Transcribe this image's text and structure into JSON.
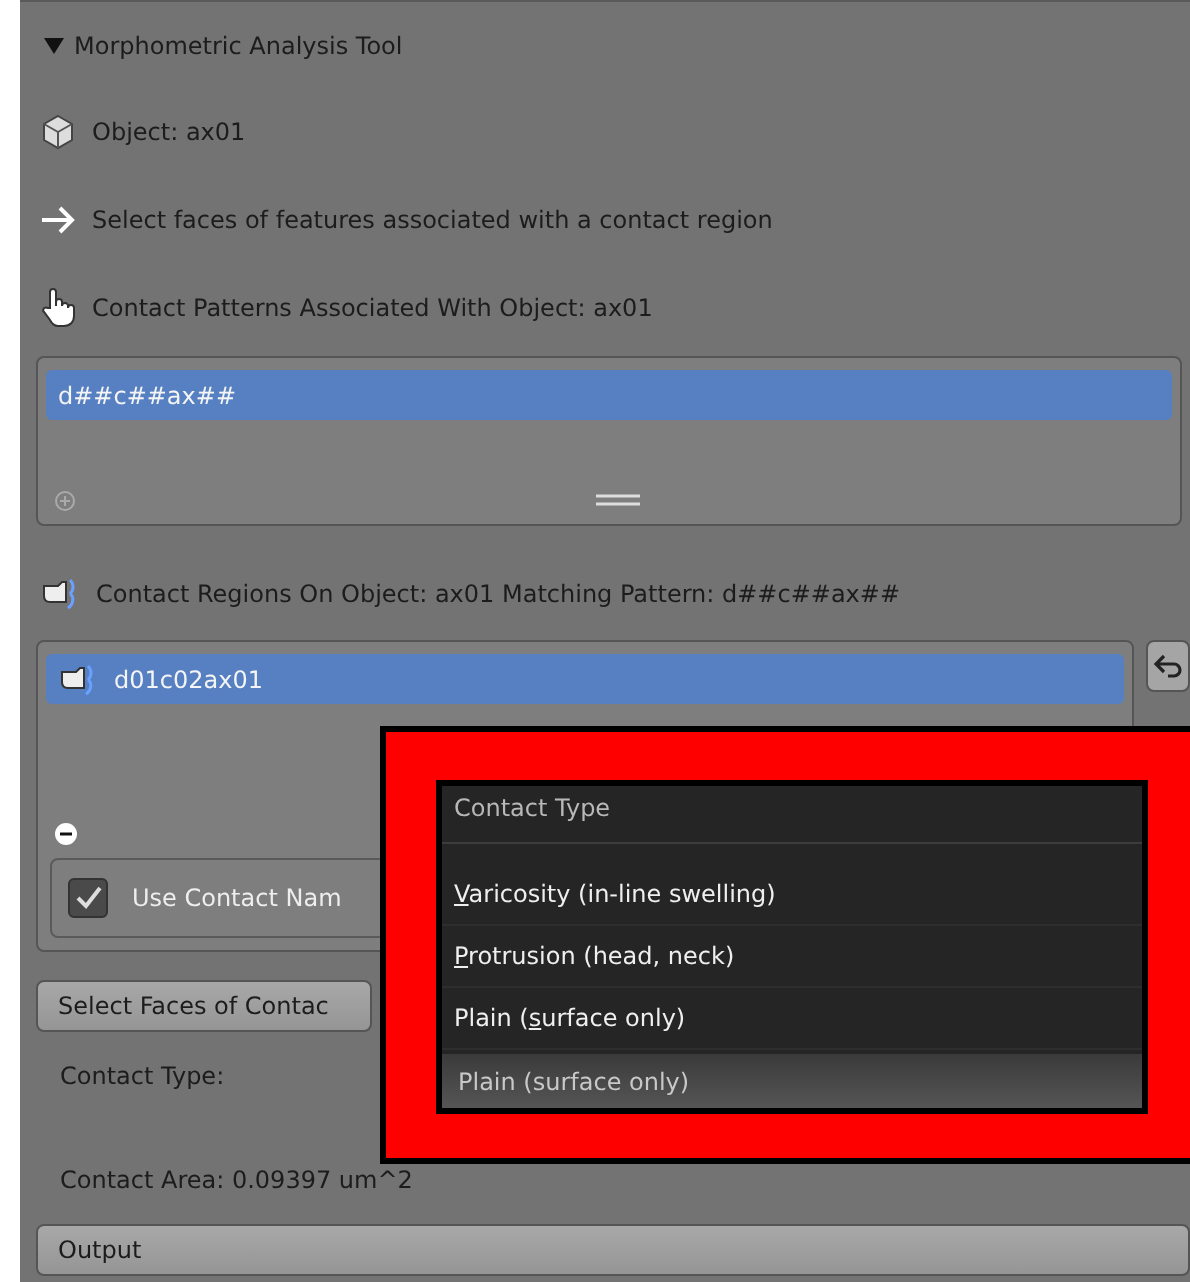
{
  "panel": {
    "title": "Morphometric Analysis Tool",
    "expanded": true
  },
  "object_label": "Object: ax01",
  "instruction": "Select faces of features associated with a contact region",
  "patterns": {
    "heading": "Contact Patterns Associated With Object:  ax01",
    "items": [
      {
        "label": "d##c##ax##",
        "selected": true
      }
    ]
  },
  "regions": {
    "heading": "Contact Regions On Object:  ax01  Matching Pattern:  d##c##ax##",
    "items": [
      {
        "label": "d01c02ax01",
        "selected": true
      }
    ]
  },
  "use_contact_name": {
    "label": "Use Contact Nam",
    "checked": true
  },
  "select_faces_button": "Select Faces of Contac",
  "contact_type_label": "Contact Type:",
  "contact_area": "Contact Area: 0.09397 um^2",
  "output_button": "Output",
  "popup": {
    "title": "Contact Type",
    "items": [
      {
        "key": "V",
        "after": "aricosity (in-line swelling)"
      },
      {
        "key": "P",
        "after": "rotrusion (head, neck)"
      },
      {
        "before": "Plain (",
        "key": "s",
        "after": "urface only)"
      }
    ],
    "current": "Plain (surface only)"
  }
}
